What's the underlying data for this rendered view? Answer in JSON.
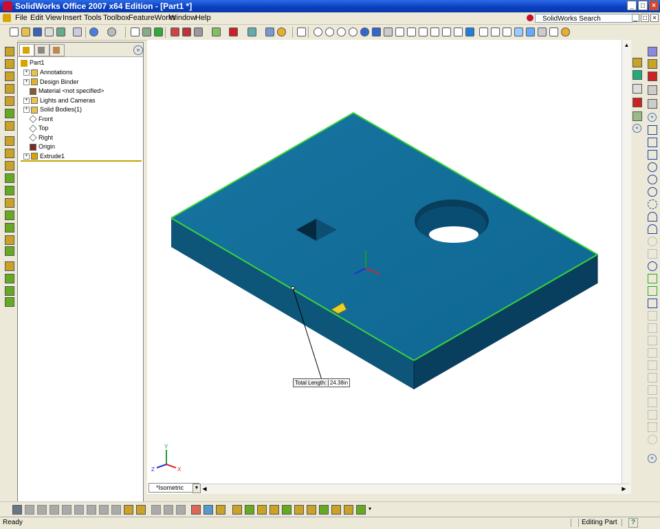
{
  "window": {
    "title": "SolidWorks Office 2007 x64 Edition - [Part1 *]"
  },
  "menu": {
    "items": [
      "File",
      "Edit",
      "View",
      "Insert",
      "Tools",
      "Toolbox",
      "FeatureWorks",
      "Window",
      "Help"
    ]
  },
  "search": {
    "label": "SolidWorks Search"
  },
  "feature_tree": {
    "root": "Part1",
    "items": [
      {
        "label": "Annotations",
        "expandable": true,
        "icon": "annotations-icon"
      },
      {
        "label": "Design Binder",
        "expandable": true,
        "icon": "design-binder-icon"
      },
      {
        "label": "Material <not specified>",
        "expandable": false,
        "icon": "material-icon"
      },
      {
        "label": "Lights and Cameras",
        "expandable": true,
        "icon": "lights-icon"
      },
      {
        "label": "Solid Bodies(1)",
        "expandable": true,
        "icon": "solid-bodies-icon"
      },
      {
        "label": "Front",
        "expandable": false,
        "icon": "plane-icon"
      },
      {
        "label": "Top",
        "expandable": false,
        "icon": "plane-icon"
      },
      {
        "label": "Right",
        "expandable": false,
        "icon": "plane-icon"
      },
      {
        "label": "Origin",
        "expandable": false,
        "icon": "origin-icon"
      },
      {
        "label": "Extrude1",
        "expandable": true,
        "icon": "extrude-icon"
      }
    ]
  },
  "measure": {
    "label": "Total Length:",
    "value": "24.38in"
  },
  "view": {
    "current": "*Isometric"
  },
  "triad": {
    "x": "X",
    "y": "Y",
    "z": "Z"
  },
  "status": {
    "left": "Ready",
    "mode": "Editing Part",
    "help": "?"
  },
  "colors": {
    "model_face": "#0f6a94",
    "model_side": "#0a4a6e",
    "edge_highlight": "#39d43a",
    "title_bar": "#0a3fbf"
  }
}
